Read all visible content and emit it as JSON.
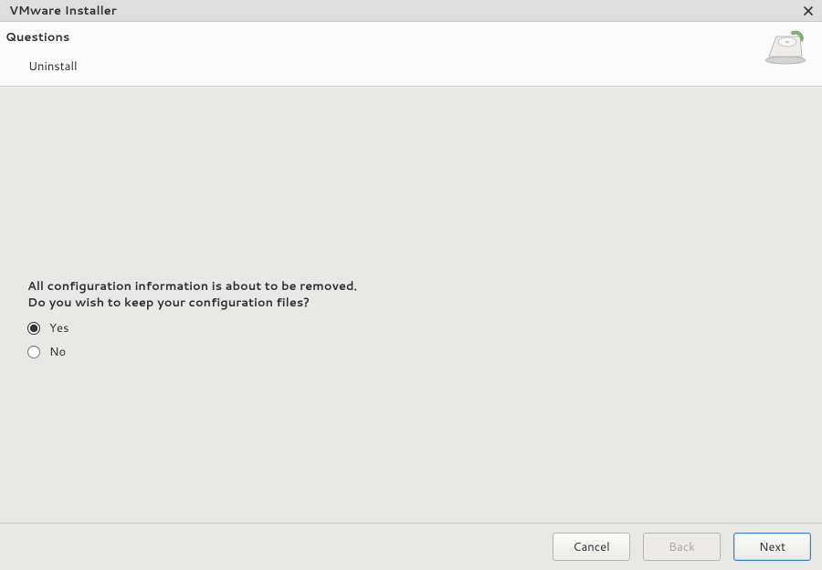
{
  "window": {
    "title": "VMware Installer"
  },
  "header": {
    "section_title": "Questions",
    "section_subtitle": "Uninstall",
    "icon_name": "drive-remove-icon"
  },
  "content": {
    "question_line1": "All configuration information is about to be removed.",
    "question_line2": "Do you wish to keep your configuration files?",
    "options": {
      "yes": "Yes",
      "no": "No"
    },
    "selected": "yes"
  },
  "footer": {
    "cancel": "Cancel",
    "back": "Back",
    "next": "Next",
    "back_enabled": false
  }
}
